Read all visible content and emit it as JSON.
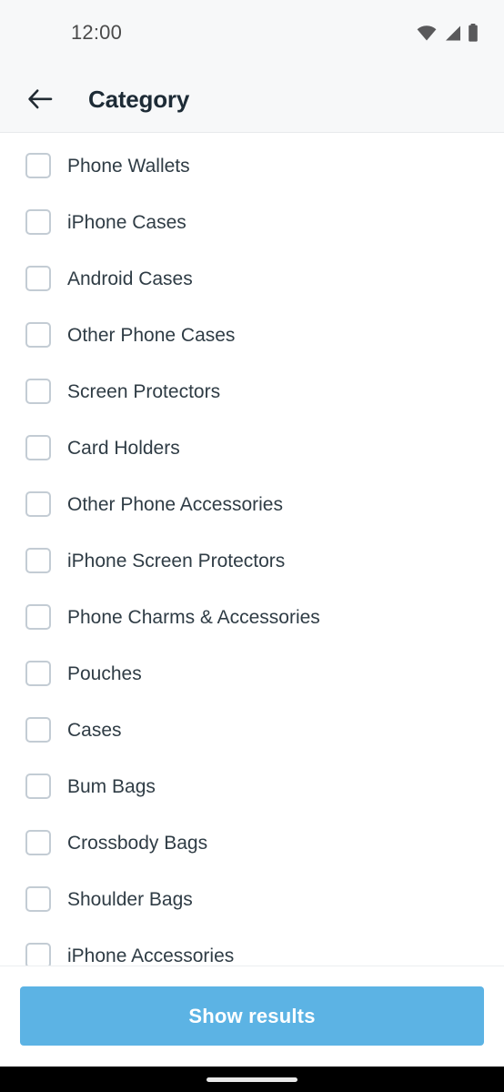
{
  "status_bar": {
    "time": "12:00",
    "icons": [
      "wifi-icon",
      "cellular-signal-icon",
      "battery-icon"
    ]
  },
  "app_bar": {
    "back_icon": "arrow-left-icon",
    "title": "Category"
  },
  "list": {
    "items": [
      {
        "label": "Phone Wallets",
        "checked": false
      },
      {
        "label": "iPhone Cases",
        "checked": false
      },
      {
        "label": "Android Cases",
        "checked": false
      },
      {
        "label": "Other Phone Cases",
        "checked": false
      },
      {
        "label": "Screen Protectors",
        "checked": false
      },
      {
        "label": "Card Holders",
        "checked": false
      },
      {
        "label": "Other Phone Accessories",
        "checked": false
      },
      {
        "label": "iPhone Screen Protectors",
        "checked": false
      },
      {
        "label": "Phone Charms & Accessories",
        "checked": false
      },
      {
        "label": "Pouches",
        "checked": false
      },
      {
        "label": "Cases",
        "checked": false
      },
      {
        "label": "Bum Bags",
        "checked": false
      },
      {
        "label": "Crossbody Bags",
        "checked": false
      },
      {
        "label": "Shoulder Bags",
        "checked": false
      },
      {
        "label": "iPhone Accessories",
        "checked": false
      }
    ]
  },
  "footer": {
    "show_results_label": "Show results"
  },
  "colors": {
    "accent": "#5cb3e4",
    "header_background": "#f7f8f9",
    "title_text": "#1d2b36",
    "item_text": "#2f3c45",
    "checkbox_border": "#c3ccd4",
    "nav_bar": "#000000"
  }
}
